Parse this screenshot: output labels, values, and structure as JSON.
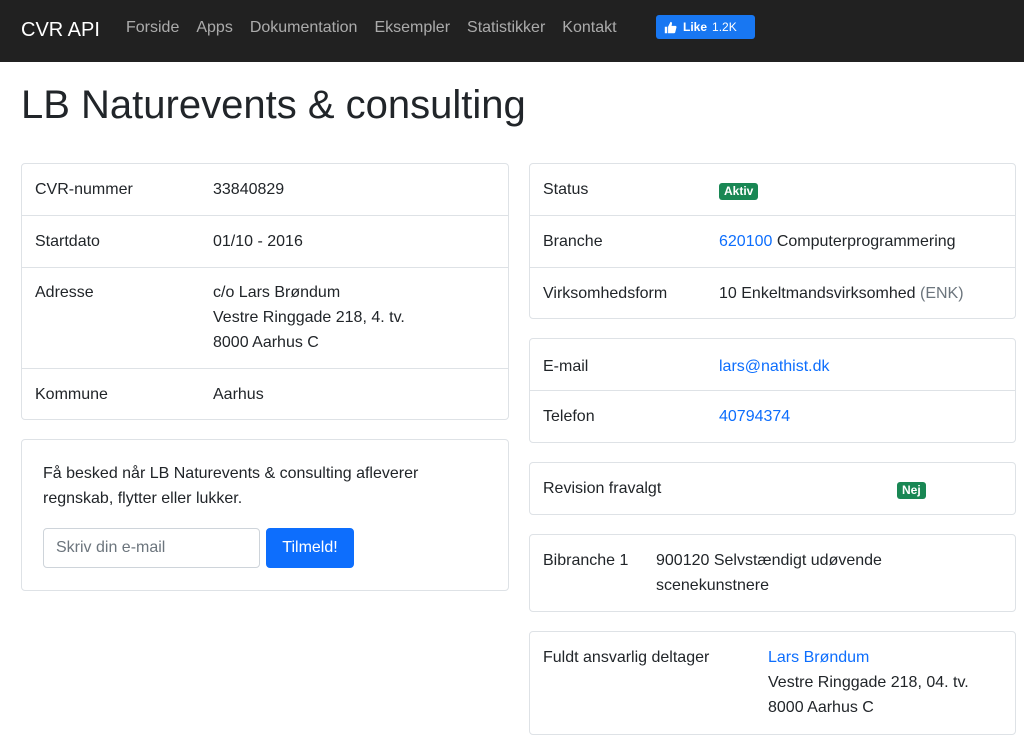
{
  "navbar": {
    "brand": "CVR API",
    "links": [
      "Forside",
      "Apps",
      "Dokumentation",
      "Eksempler",
      "Statistikker",
      "Kontakt"
    ],
    "fb_like": {
      "label": "Like",
      "count": "1.2K",
      "color": "#1877f2"
    }
  },
  "company": {
    "name": "LB Naturevents & consulting"
  },
  "info_left": {
    "cvr_label": "CVR-nummer",
    "cvr_value": "33840829",
    "start_label": "Startdato",
    "start_value": "01/10 - 2016",
    "address_label": "Adresse",
    "address_lines": [
      "c/o Lars Brøndum",
      "Vestre Ringgade 218, 4. tv.",
      "8000 Aarhus C"
    ],
    "kommune_label": "Kommune",
    "kommune_value": "Aarhus"
  },
  "notify": {
    "text": "Få besked når LB Naturevents & consulting afleverer regnskab, flytter eller lukker.",
    "placeholder": "Skriv din e-mail",
    "button": "Tilmeld!"
  },
  "info_right": {
    "status_label": "Status",
    "status_badge": "Aktiv",
    "branche_label": "Branche",
    "branche_code": "620100",
    "branche_text": "Computerprogrammering",
    "form_label": "Virksomhedsform",
    "form_text": "10 Enkeltmandsvirksomhed",
    "form_abbr": "(ENK)"
  },
  "contact": {
    "email_label": "E-mail",
    "email_value": "lars@nathist.dk",
    "phone_label": "Telefon",
    "phone_value": "40794374"
  },
  "revision": {
    "label": "Revision fravalgt",
    "badge": "Nej"
  },
  "bibranche": {
    "label": "Bibranche 1",
    "lines": [
      "900120 Selvstændigt udøvende",
      "scenekunstnere"
    ]
  },
  "deltager": {
    "label": "Fuldt ansvarlig deltager",
    "name": "Lars Brøndum",
    "address_lines": [
      "Vestre Ringgade 218, 04. tv.",
      "8000 Aarhus C"
    ]
  },
  "colors": {
    "link": "#0d6efd",
    "badge_green": "#198754",
    "navbar_bg": "#212121"
  }
}
